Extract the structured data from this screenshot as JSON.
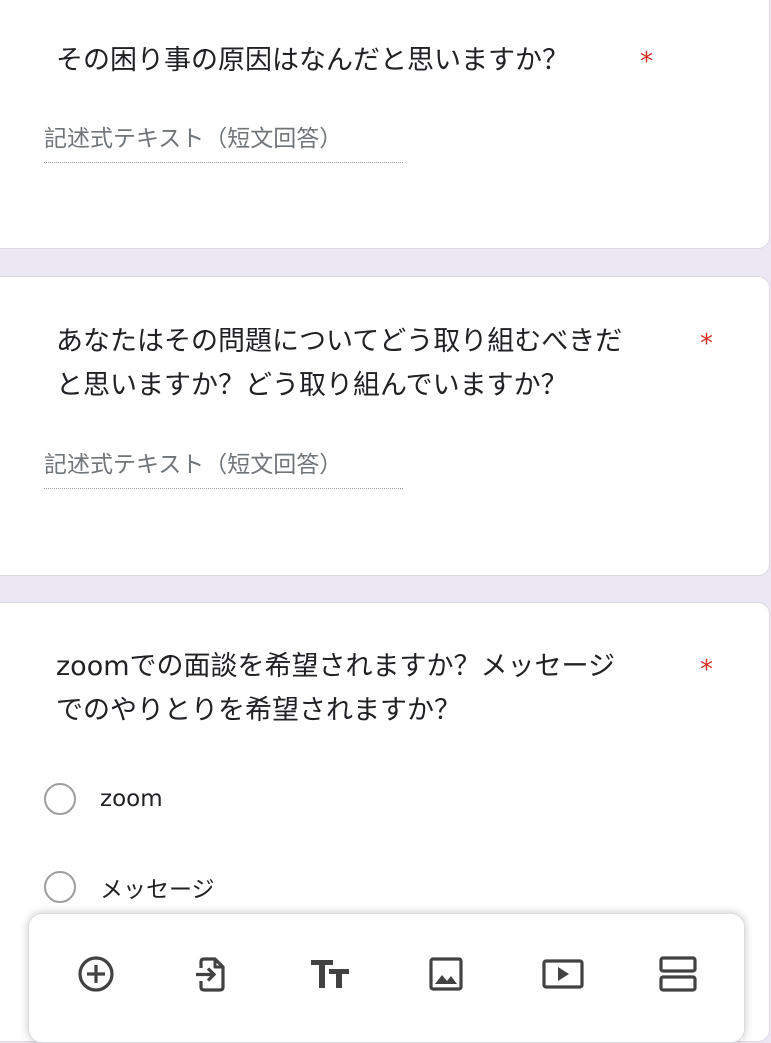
{
  "questions": [
    {
      "title": "その困り事の原因はなんだと思いますか？",
      "required_mark": "*",
      "type": "short-text",
      "placeholder": "記述式テキスト（短文回答）"
    },
    {
      "title_line1": "あなたはその問題についてどう取り組むべきだ",
      "title_line2": "と思いますか？どう取り組んでいますか？",
      "required_mark": "*",
      "type": "short-text",
      "placeholder": "記述式テキスト（短文回答）"
    },
    {
      "title_line1": "zoomでの面談を希望されますか？メッセージ",
      "title_line2": "でのやりとりを希望されますか？",
      "required_mark": "*",
      "type": "radio",
      "options": [
        "zoom",
        "メッセージ"
      ]
    }
  ],
  "toolbar": {
    "icons": [
      "add-question-icon",
      "import-questions-icon",
      "add-title-icon",
      "add-image-icon",
      "add-video-icon",
      "add-section-icon"
    ],
    "icon_color": "#424242"
  },
  "colors": {
    "background": "#ece8f3",
    "required": "#d93025",
    "card": "#ffffff"
  }
}
